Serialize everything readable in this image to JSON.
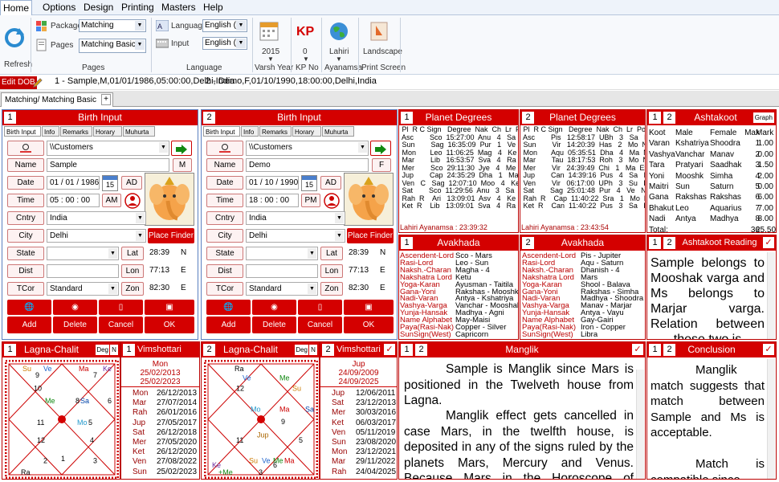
{
  "menu": [
    "Home",
    "Options",
    "Design",
    "Printing",
    "Masters",
    "Help"
  ],
  "ribbon": {
    "refresh": "Refresh",
    "package_label": "Package",
    "package_value": "Matching",
    "pages_label": "Pages",
    "pages_value": "Matching Basic",
    "pages_group": "Pages",
    "language_label": "Language",
    "language_value": "English (E",
    "input_label": "Input",
    "input_value": "English (E",
    "language_group": "Language",
    "varsh_value": "2015",
    "varsh_label": "Varsh Year",
    "kp_value": "0",
    "kp_label": "KP No",
    "ayanamsa_value": "Lahiri",
    "ayanamsa_label": "Ayanamsa",
    "print_value": "Landscape",
    "print_label": "Print Screen"
  },
  "infobar": {
    "edit_dob": "Edit DOB",
    "person1": "1 - Sample,M,01/01/1986,05:00:00,Delhi,India",
    "person2": "2 - Demo,F,01/10/1990,18:00:00,Delhi,India"
  },
  "doc_tab": "Matching/ Matching Basic",
  "doc_tab_close": "✖",
  "doc_tab_add": "+",
  "birth": [
    {
      "num": "1",
      "title": "Birth Input",
      "tabs": [
        "Birth Input",
        "Info",
        "Remarks",
        "Horary",
        "Muhurta"
      ],
      "folder": "\\\\Customers",
      "labels": {
        "name": "Name",
        "date": "Date",
        "time": "Time",
        "cntry": "Cntry",
        "city": "City",
        "state": "State",
        "dist": "Dist",
        "tcor": "TCor"
      },
      "name": "Sample",
      "gender": "M",
      "date": "01 / 01 /  1986",
      "date_btn": "AD",
      "time": "05  :  00  :  00",
      "time_btn": "AM",
      "cntry": "India",
      "city": "Delhi",
      "place_finder": "Place Finder",
      "lat_label": "Lat",
      "lat": "28:39",
      "lat_dir": "N",
      "lon_label": "Lon",
      "lon": "77:13",
      "lon_dir": "E",
      "zon_label": "Zon",
      "zon": "82:30",
      "zon_dir": "E",
      "tcor": "Standard",
      "cal": "15",
      "buttons": [
        "Add",
        "Delete",
        "Cancel",
        "OK"
      ]
    },
    {
      "num": "2",
      "title": "Birth Input",
      "tabs": [
        "Birth Input",
        "Info",
        "Remarks",
        "Horary",
        "Muhurta"
      ],
      "folder": "\\\\Customers",
      "labels": {
        "name": "Name",
        "date": "Date",
        "time": "Time",
        "cntry": "Cntry",
        "city": "City",
        "state": "State",
        "dist": "Dist",
        "tcor": "TCor"
      },
      "name": "Demo",
      "gender": "F",
      "date": "01 / 10 /  1990",
      "date_btn": "AD",
      "time": "18  :  00  :  00",
      "time_btn": "PM",
      "cntry": "India",
      "city": "Delhi",
      "place_finder": "Place Finder",
      "lat_label": "Lat",
      "lat": "28:39",
      "lat_dir": "N",
      "lon_label": "Lon",
      "lon": "77:13",
      "lon_dir": "E",
      "zon_label": "Zon",
      "zon": "82:30",
      "zon_dir": "E",
      "tcor": "Standard",
      "cal": "15",
      "buttons": [
        "Add",
        "Delete",
        "Cancel",
        "OK"
      ]
    }
  ],
  "planet_degrees": [
    {
      "num": "1",
      "title": "Planet Degrees",
      "table": " Pl  R C Sign   Degree  Nak  Ch  Lr  Pos\n Asc        Sco  15:27:00  Anu   4   Sa   R\n Sun        Sag  16:35:09  Pur   1   Ve   Fr\n Mon       Leo  11:06:25  Mag   4   Ke   Fr\n Mar        Lib   16:53:57  Sva   4   Ra   Nu\n Mer        Sco  29:11:30  Jye   4   Me  Nu\n Jup        Cap  24:35:29  Dha   1   Ma  Db\n Ven   C   Sag  12:07:10  Moo   4   Ke   Nu\n Sat        Sco  11:29:56  Anu   3   Sa   En\n Rah  R    Ari   13:09:01  Asv   4   Ke   En\n Ket  R    Lib   13:09:01  Sva   4   Ra   En",
      "footer": "Lahiri Ayanamsa : 23:39:32"
    },
    {
      "num": "2",
      "title": "Planet Degrees",
      "table": " Pl  R C Sign   Degree  Nak  Ch  Lr  Pos\n Asc        Pis   12:58:17  UBh   3   Sa   Nu\n Sun        Vir   14:20:39  Has   2   Mo  Nu\n Mon       Aqu  05:35:51  Dha   4   Ma  Nu\n Mar        Tau  18:17:53  Roh   3   Mo  Nu\n Mer        Vir   24:39:49  Chi   1   Ma  Ex\n Jup        Can  14:39:16  Pus   4   Sa   Ex\n Ven        Vir   06:17:00  UPh   3   Su   Db\n Sat        Sag  25:01:48  Pur   4   Ve   Nu\n Rah  R    Cap  11:40:22  Sra   1   Mo  Fr\n Ket  R    Can  11:40:22  Pus   3   Sa   Fr",
      "footer": "Lahiri Ayanamsa : 23:43:54"
    }
  ],
  "ashtakoot": {
    "num1": "1",
    "num2": "2",
    "title": "Ashtakoot",
    "graph": "Graph",
    "header": [
      "Koot",
      "Male",
      "Female",
      "Max",
      "Mark"
    ],
    "rows": [
      [
        "Varan",
        "Kshatriya",
        "Shoodra",
        "1",
        "1.00"
      ],
      [
        "Vashya",
        "Vanchar",
        "Manav",
        "2",
        "0.00"
      ],
      [
        "Tara",
        "Pratyari",
        "Saadhak",
        "3",
        "1.50"
      ],
      [
        "Yoni",
        "Mooshk",
        "Simha",
        "4",
        "2.00"
      ],
      [
        "Maitri",
        "Sun",
        "Saturn",
        "5",
        "0.00"
      ],
      [
        "Gana",
        "Rakshas",
        "Rakshas",
        "6",
        "6.00"
      ],
      [
        "Bhakut",
        "Leo",
        "Aquarius",
        "7",
        "7.00"
      ],
      [
        "Nadi",
        "Antya",
        "Madhya",
        "8",
        "8.00"
      ],
      [
        "Total:",
        "",
        "",
        "36",
        "25.50"
      ]
    ]
  },
  "avakhada": [
    {
      "num": "1",
      "title": "Avakhada",
      "labels": "Ascendent-Lord\nRasi-Lord\nNaksh.-Charan\nNakshatra Lord\nYoga-Karan\nGana-Yoni\nNadi-Varan\nVashya-Varga\nYunja-Hansak\nName Alphabet\nPaya(Rasi-Nak)\nSunSign(West)",
      "values": "Sco - Mars\nLeo - Sun\nMagha - 4\nKetu\nAyusman - Taitila\nRakshas - Mooshk\nAntya - Kshatriya\nVanchar - Mooshak\nMadhya - Agni\nMay-Maisi\nCopper - Silver\nCapricorn"
    },
    {
      "num": "2",
      "title": "Avakhada",
      "labels": "Ascendent-Lord\nRasi-Lord\nNaksh.-Charan\nNakshatra Lord\nYoga-Karan\nGana-Yoni\nNadi-Varan\nVashya-Varga\nYunja-Hansak\nName Alphabet\nPaya(Rasi-Nak)\nSunSign(West)",
      "values": "Pis - Jupiter\nAqu - Saturn\nDhanish - 4\nMars\nShool - Balava\nRakshas - Simha\nMadhya - Shoodra\nManav - Marjar\nAntya - Vayu\nGay-Gairi\nIron - Copper\nLibra"
    }
  ],
  "ashtakoot_reading": {
    "num1": "1",
    "num2": "2",
    "title": "Ashtakoot Reading",
    "text": "Sample belongs to Mooshak varga and Ms belongs to Marjar varga. Relation between these two is"
  },
  "lagna": [
    {
      "num": "1",
      "title": "Lagna-Chalit",
      "deg": "Deg",
      "n": "N",
      "chart": {
        "houses": [
          "Ve",
          "Ma",
          "Ke",
          "Me 8 Sa",
          "6",
          "",
          "11",
          "Mo 5",
          "",
          "Ra",
          "",
          ""
        ],
        "n": [
          "9",
          "7",
          "10",
          "4",
          "1",
          "",
          ""
        ]
      }
    },
    {
      "num": "2",
      "title": "Lagna-Chalit",
      "deg": "Deg",
      "n": "N"
    }
  ],
  "vimshottari": [
    {
      "num": "1",
      "title": "Vimshottari",
      "head": "Mon",
      "start": "25/02/2013",
      "end": "25/02/2023",
      "rows": [
        [
          "Mon",
          "26/12/2013"
        ],
        [
          "Mar",
          "27/07/2014"
        ],
        [
          "Rah",
          "26/01/2016"
        ],
        [
          "Jup",
          "27/05/2017"
        ],
        [
          "Sat",
          "26/12/2018"
        ],
        [
          "Mer",
          "27/05/2020"
        ],
        [
          "Ket",
          "26/12/2020"
        ],
        [
          "Ven",
          "27/08/2022"
        ],
        [
          "Sun",
          "25/02/2023"
        ]
      ]
    },
    {
      "num": "2",
      "title": "Vimshottari",
      "head": "Jup",
      "start": "24/09/2009",
      "end": "24/09/2025",
      "rows": [
        [
          "Jup",
          "12/06/2011"
        ],
        [
          "Sat",
          "23/12/2013"
        ],
        [
          "Mer",
          "30/03/2016"
        ],
        [
          "Ket",
          "06/03/2017"
        ],
        [
          "Ven",
          "05/11/2019"
        ],
        [
          "Sun",
          "23/08/2020"
        ],
        [
          "Mon",
          "23/12/2021"
        ],
        [
          "Mar",
          "29/11/2022"
        ],
        [
          "Rah",
          "24/04/2025"
        ]
      ]
    }
  ],
  "manglik": {
    "num1": "1",
    "num2": "2",
    "title": "Manglik",
    "text1": "Sample is Manglik since Mars is positioned in the Twelveth house from Lagna.",
    "text2": "Manglik effect gets cancelled in case Mars, in the twelfth house, is deposited in any of the signs ruled by the planets Mars, Mercury and Venus. Because Mars in the Horoscope of Sample is placed in Twelveth"
  },
  "conclusion": {
    "num1": "1",
    "num2": "2",
    "title": "Conclusion",
    "text1": "Manglik match suggests that match between Sample and Ms is acceptable.",
    "text2": "Match is compatible since"
  },
  "chart1": {
    "labels": [
      [
        "Su",
        "22",
        "22"
      ],
      [
        "Ve",
        "48",
        "22"
      ],
      [
        "Ma",
        "92",
        "22"
      ],
      [
        "Ke",
        "122",
        "22"
      ],
      [
        "9",
        "38",
        "34"
      ],
      [
        "7",
        "110",
        "34"
      ],
      [
        "10",
        "36",
        "60"
      ],
      [
        "Me",
        "50",
        "84"
      ],
      [
        "8",
        "88",
        "84"
      ],
      [
        "Sa",
        "94",
        "84"
      ],
      [
        "6",
        "128",
        "84"
      ],
      [
        "11",
        "40",
        "126"
      ],
      [
        "Mo",
        "90",
        "126"
      ],
      [
        "5",
        "104",
        "126"
      ],
      [
        "12",
        "40",
        "160"
      ],
      [
        "4",
        "106",
        "160"
      ],
      [
        "2",
        "48",
        "200"
      ],
      [
        "1",
        "70",
        "196"
      ],
      [
        "3",
        "110",
        "200"
      ],
      [
        "Ra",
        "20",
        "222"
      ]
    ],
    "colors": {
      "Su": "#cc7a00",
      "Ve": "#2266cc",
      "Ma": "#cc0000",
      "Ke": "#6a2d9f",
      "Me": "#118811",
      "Sa": "#0044aa",
      "Mo": "#2299cc",
      "Ra": "#000000"
    }
  },
  "chart2": {
    "labels": [
      [
        "Ra",
        "38",
        "22"
      ],
      [
        "Ve",
        "48",
        "40"
      ],
      [
        "Me",
        "94",
        "40"
      ],
      [
        "12",
        "40",
        "60"
      ],
      [
        "Su",
        "110",
        "60"
      ],
      [
        "Mo",
        "58",
        "100"
      ],
      [
        "Ma",
        "94",
        "100"
      ],
      [
        "Sa",
        "126",
        "100"
      ],
      [
        "9",
        "96",
        "124"
      ],
      [
        "Jup",
        "66",
        "150"
      ],
      [
        "11",
        "40",
        "160"
      ],
      [
        "5",
        "118",
        "160"
      ],
      [
        "Su",
        "56",
        "200"
      ],
      [
        "Ve",
        "72",
        "200"
      ],
      [
        "Me",
        "86",
        "200"
      ],
      [
        "Ma",
        "100",
        "200"
      ],
      [
        "6",
        "86",
        "208"
      ],
      [
        "Ke",
        "10",
        "208"
      ],
      [
        "+Me",
        "18",
        "222"
      ],
      [
        "3",
        "68",
        "222"
      ]
    ],
    "colors": {
      "Ra": "#000000",
      "Ve": "#2266cc",
      "Me": "#118811",
      "Su": "#cc7a00",
      "Mo": "#2299cc",
      "Ma": "#cc0000",
      "Sa": "#0044aa",
      "Jup": "#aa6600",
      "Ke": "#6a2d9f",
      "+Me": "#118811"
    }
  }
}
